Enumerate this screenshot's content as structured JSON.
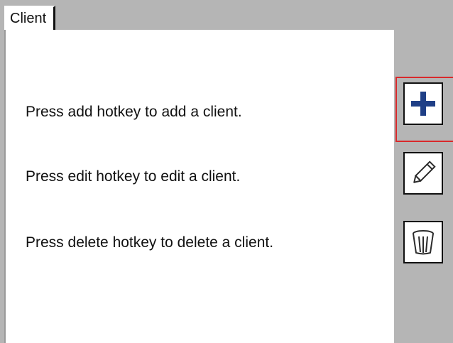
{
  "tabs": [
    {
      "label": "Client",
      "active": true
    }
  ],
  "messages": {
    "add": "Press add hotkey to add a client.",
    "edit": "Press edit hotkey to edit a client.",
    "delete": "Press delete hotkey to delete a client."
  },
  "hotkeys": [
    {
      "name": "add",
      "icon": "plus-icon",
      "focused": true
    },
    {
      "name": "edit",
      "icon": "pencil-icon",
      "focused": false
    },
    {
      "name": "delete",
      "icon": "trash-icon",
      "focused": false
    }
  ],
  "colors": {
    "background": "#b5b5b5",
    "panel": "#ffffff",
    "text": "#111111",
    "accent_blue": "#1f3f86",
    "focus_red": "#d9292b"
  }
}
